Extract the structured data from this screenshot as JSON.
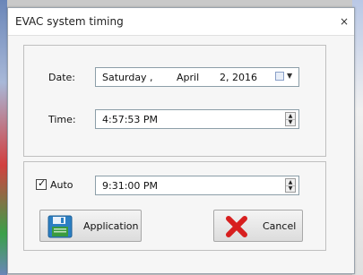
{
  "window": {
    "title": "EVAC system timing",
    "close_glyph": "×"
  },
  "date": {
    "label": "Date:",
    "weekday": "Saturday",
    "sep": ",",
    "month": "April",
    "day_year": "2, 2016",
    "picker_icon": "calendar-dropdown-icon"
  },
  "time": {
    "label": "Time:",
    "value": "4:57:53 PM"
  },
  "auto": {
    "label": "Auto",
    "checked": true,
    "value": "9:31:00 PM"
  },
  "buttons": {
    "apply": {
      "label": "Application",
      "icon": "floppy-disk-icon"
    },
    "cancel": {
      "label": "Cancel",
      "icon": "red-x-icon"
    }
  },
  "colors": {
    "accent_blue": "#2c7fc3",
    "cancel_red": "#d71f1f",
    "save_green": "#3a9b3e"
  }
}
